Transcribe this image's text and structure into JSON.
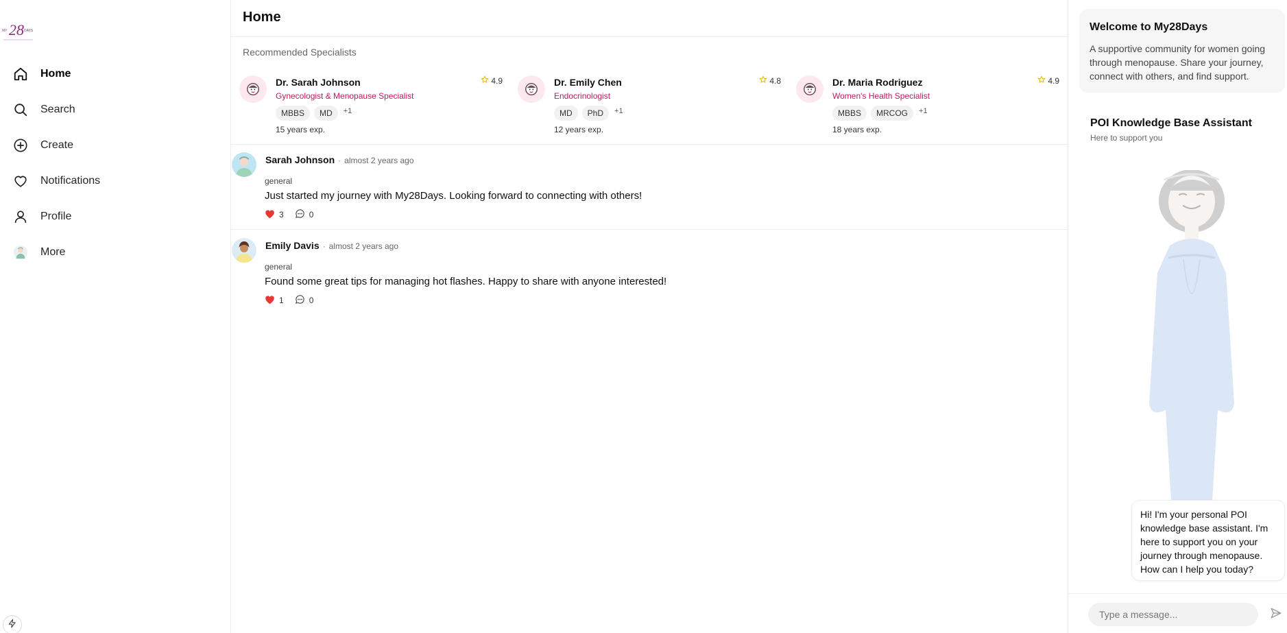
{
  "brand": {
    "logo_number": "28",
    "logo_left": "MY",
    "logo_right": "DAYS",
    "accent_color": "#c2185b"
  },
  "sidebar": {
    "items": [
      {
        "label": "Home",
        "icon": "home-icon"
      },
      {
        "label": "Search",
        "icon": "search-icon"
      },
      {
        "label": "Create",
        "icon": "plus-circle-icon"
      },
      {
        "label": "Notifications",
        "icon": "heart-icon"
      },
      {
        "label": "Profile",
        "icon": "user-icon"
      },
      {
        "label": "More",
        "icon": "avatar-icon"
      }
    ]
  },
  "main": {
    "title": "Home",
    "recommended_title": "Recommended Specialists",
    "specialists": [
      {
        "name": "Dr. Sarah Johnson",
        "title": "Gynecologist & Menopause Specialist",
        "rating": "4.9",
        "tags": [
          "MBBS",
          "MD"
        ],
        "more": "+1",
        "experience": "15 years exp."
      },
      {
        "name": "Dr. Emily Chen",
        "title": "Endocrinologist",
        "rating": "4.8",
        "tags": [
          "MD",
          "PhD"
        ],
        "more": "+1",
        "experience": "12 years exp."
      },
      {
        "name": "Dr. Maria Rodriguez",
        "title": "Women's Health Specialist",
        "rating": "4.9",
        "tags": [
          "MBBS",
          "MRCOG"
        ],
        "more": "+1",
        "experience": "18 years exp."
      }
    ],
    "posts": [
      {
        "author": "Sarah Johnson",
        "separator": "·",
        "time": "almost 2 years ago",
        "tag": "general",
        "text": "Just started my journey with My28Days. Looking forward to connecting with others!",
        "likes": "3",
        "comments": "0"
      },
      {
        "author": "Emily Davis",
        "separator": "·",
        "time": "almost 2 years ago",
        "tag": "general",
        "text": "Found some great tips for managing hot flashes. Happy to share with anyone interested!",
        "likes": "1",
        "comments": "0"
      }
    ]
  },
  "right": {
    "welcome_title": "Welcome to My28Days",
    "welcome_text": "A supportive community for women going through menopause. Share your journey, connect with others, and find support.",
    "assistant_title": "POI Knowledge Base Assistant",
    "assistant_subtitle": "Here to support you",
    "assistant_message": "Hi! I'm your personal POI knowledge base assistant. I'm here to support you on your journey through menopause. How can I help you today?",
    "input_placeholder": "Type a message..."
  }
}
